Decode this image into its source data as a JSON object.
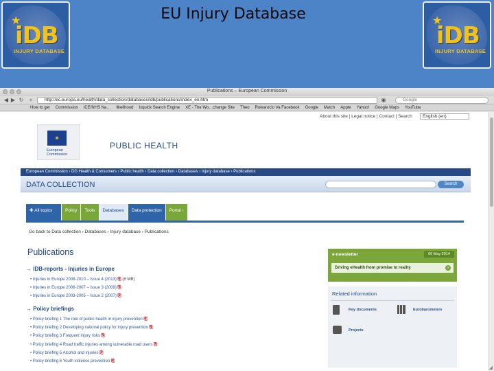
{
  "slide": {
    "title": "EU Injury Database",
    "logo_text": "iDB",
    "logo_sub": "INJURY DATABASE"
  },
  "browser": {
    "window_title": "Publications – European Commission",
    "url": "http://ec.europa.eu/health/data_collection/databases/idb/publications/index_en.htm",
    "search_placeholder": "Google",
    "bookmarks": [
      "How to get",
      "Commission",
      "ICE/NHS Na…",
      "likelihood",
      "Ixquick Search Engine",
      "XE - The Wo…change Site",
      "Theo",
      "Roivarocio Va Facebook",
      "Google",
      "Match",
      "Apple",
      "Yahoo!",
      "Google Maps",
      "YouTube"
    ]
  },
  "page": {
    "utility_links": "About this site | Legal notice | Contact | Search",
    "language": "English (en)",
    "ec_logo_text": "European\nCommission",
    "site_title": "PUBLIC HEALTH",
    "top_breadcrumb": "European Commission › DG Health & Consumers › Public health › Data collection › Databases › Injury database › Publications",
    "section_title": "DATA COLLECTION",
    "search_button": "Search",
    "tabs": [
      "All topics",
      "Policy",
      "Tools",
      "Databases",
      "Data protection",
      "Portal"
    ],
    "content_breadcrumb": "Go back to  Data collection  ›  Databases  ›  Injury database  ›  Publications",
    "pub_title": "Publications",
    "idb_heading": "IDB-reports - Injuries in Europe",
    "idb_items": [
      "Injuries in Europe 2008-2010 – Issue 4 (2013)",
      "Injuries in Europe 2006-2007 – Issue 3 (2009)",
      "Injuries in Europe 2003-2005 – Issue 2 (2007)"
    ],
    "idb_item1_size": "(6 MB)",
    "policy_heading": "Policy briefings",
    "policy_items": [
      "Policy briefing 1 The role of public health in injury prevention",
      "Policy briefing 2 Developing national policy for injury prevention",
      "Policy briefing 3 Frequent injury risks",
      "Policy briefing 4 Road traffic injuries among vulnerable road users",
      "Policy briefing 5 Alcohol and injuries",
      "Policy briefing 6 Youth violence prevention"
    ],
    "enews": {
      "heading": "e-newsletter",
      "date": "06 May 2014",
      "headline": "Driving eHealth from promise to reality"
    },
    "related": {
      "heading": "Related information",
      "items": [
        "Key documents",
        "Eurobarometers",
        "Projects"
      ]
    }
  },
  "colors": {
    "banner_blue": "#4d84c8",
    "ec_blue": "#234b8a",
    "tab_green": "#7aa63a",
    "pdf_red": "#c2181b"
  }
}
